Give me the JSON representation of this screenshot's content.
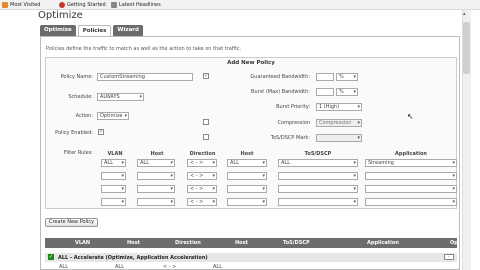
{
  "bookmarks": [
    {
      "label": "Most Visited",
      "color": "#e38b2b"
    },
    {
      "label": "Getting Started",
      "color": "#c0392b"
    },
    {
      "label": "Latest Headlines",
      "color": "#888888"
    }
  ],
  "page_title": "Optimize",
  "tabs": [
    "Optimize",
    "Policies",
    "Wizard"
  ],
  "active_tab": "Policies",
  "description": "Policies define the traffic to match as well as the action to take on that traffic.",
  "add_new_policy": {
    "header": "Add New Policy",
    "policy_name_label": "Policy Name:",
    "policy_name_value": "CustomStreaming",
    "schedule_label": "Schedule:",
    "schedule_value": "ALWAYS",
    "action_label": "Action:",
    "action_value": "Optimize",
    "policy_enabled_label": "Policy Enabled:",
    "guaranteed_bw_label": "Guaranteed Bandwidth:",
    "guaranteed_bw_unit": "%",
    "burst_max_bw_label": "Burst (Max) Bandwidth:",
    "burst_max_bw_unit": "%",
    "burst_priority_label": "Burst Priority:",
    "burst_priority_value": "1 (High)",
    "compression_label": "Compression",
    "compression_value": "Compression",
    "tos_dscp_mark_label": "ToS/DSCP Mark:",
    "filter_rules_label": "Filter Rules:",
    "filter_headers": [
      "VLAN",
      "Host",
      "Direction",
      "Host",
      "ToS/DSCP",
      "Application"
    ],
    "filter_row1": [
      "ALL",
      "ALL",
      "< - >",
      "ALL",
      "ALL",
      "Streaming"
    ],
    "filter_row_empty_dir": "< - >"
  },
  "create_button": "Create New Policy",
  "grid": {
    "headers": [
      "VLAN",
      "Host",
      "Direction",
      "Host",
      "ToS/DSCP",
      "Application",
      "Op"
    ],
    "group": "ALL - Accelerate (Optimize, Application Acceleration)",
    "row": [
      "ALL",
      "ALL",
      "< - >",
      "ALL"
    ]
  },
  "colors": {
    "tab_bg": "#6b6b6b",
    "grid_header": "#6d6d6d",
    "group_check": "#1a8a1a"
  }
}
